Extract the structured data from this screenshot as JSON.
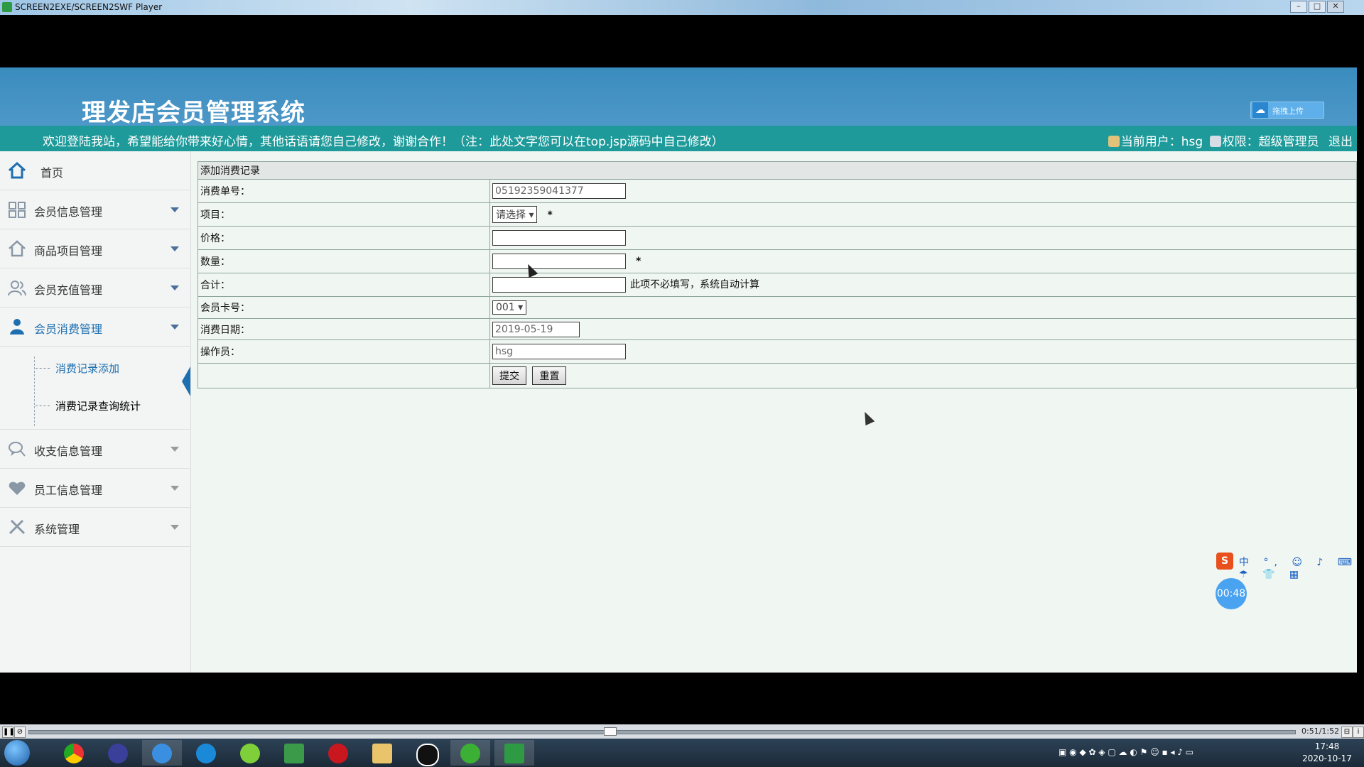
{
  "window": {
    "title": "SCREEN2EXE/SCREEN2SWF Player",
    "controls": [
      "–",
      "□",
      "✕"
    ]
  },
  "header": {
    "system_title": "理发店会员管理系统",
    "upload_label": "拖拽上传",
    "welcome_text": "欢迎登陆我站，希望能给你带来好心情，其他话语请您自己修改，谢谢合作！（注：此处文字您可以在top.jsp源码中自己修改）",
    "current_user_text": "当前用户：hsg",
    "permission_text": "权限：超级管理员",
    "logout_label": "退出"
  },
  "sidebar": {
    "home_label": "首页",
    "items": [
      {
        "label": "会员信息管理",
        "icon": "grid-icon"
      },
      {
        "label": "商品项目管理",
        "icon": "house-icon"
      },
      {
        "label": "会员充值管理",
        "icon": "users-icon"
      },
      {
        "label": "会员消费管理",
        "icon": "person-icon"
      },
      {
        "label": "收支信息管理",
        "icon": "chat-icon"
      },
      {
        "label": "员工信息管理",
        "icon": "heart-icon"
      },
      {
        "label": "系统管理",
        "icon": "tools-icon"
      }
    ],
    "sub_items": [
      "消费记录添加",
      "消费记录查询统计"
    ]
  },
  "form": {
    "title": "添加消费记录",
    "order_no_label": "消费单号：",
    "order_no_value": "05192359041377",
    "item_label": "项目：",
    "item_select": "请选择",
    "price_label": "价格：",
    "quantity_label": "数量：",
    "total_label": "合计：",
    "total_note": "此项不必填写，系统自动计算",
    "card_label": "会员卡号：",
    "card_select": "001",
    "date_label": "消费日期：",
    "date_value": "2019-05-19",
    "operator_label": "操作员：",
    "operator_value": "hsg",
    "required_mark": "*",
    "submit_label": "提交",
    "reset_label": "重置"
  },
  "overlay": {
    "ime_chars": "中 °, ☺ ♪ ⌨ ☂ 👕 ▦",
    "timer": "00:48"
  },
  "player": {
    "time": "0:51/1:52"
  },
  "taskbar": {
    "time": "17:48",
    "date": "2020-10-17"
  }
}
